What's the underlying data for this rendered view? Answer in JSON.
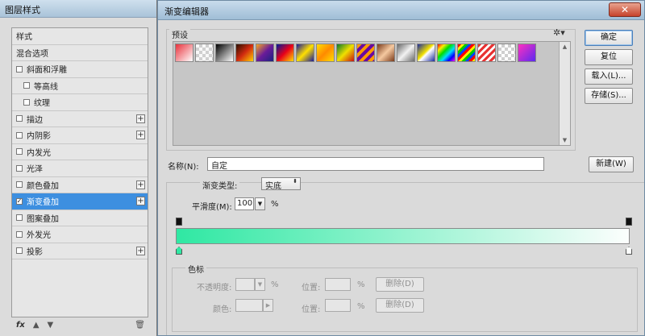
{
  "layer_style": {
    "title": "图层样式",
    "items": [
      {
        "label": "样式",
        "checkbox": false,
        "checked": false,
        "plus": false,
        "indent": false,
        "selected": false
      },
      {
        "label": "混合选项",
        "checkbox": false,
        "checked": false,
        "plus": false,
        "indent": false,
        "selected": false
      },
      {
        "label": "斜面和浮雕",
        "checkbox": true,
        "checked": false,
        "plus": false,
        "indent": false,
        "selected": false
      },
      {
        "label": "等高线",
        "checkbox": true,
        "checked": false,
        "plus": false,
        "indent": true,
        "selected": false
      },
      {
        "label": "纹理",
        "checkbox": true,
        "checked": false,
        "plus": false,
        "indent": true,
        "selected": false
      },
      {
        "label": "描边",
        "checkbox": true,
        "checked": false,
        "plus": true,
        "indent": false,
        "selected": false
      },
      {
        "label": "内阴影",
        "checkbox": true,
        "checked": false,
        "plus": true,
        "indent": false,
        "selected": false
      },
      {
        "label": "内发光",
        "checkbox": true,
        "checked": false,
        "plus": false,
        "indent": false,
        "selected": false
      },
      {
        "label": "光泽",
        "checkbox": true,
        "checked": false,
        "plus": false,
        "indent": false,
        "selected": false
      },
      {
        "label": "颜色叠加",
        "checkbox": true,
        "checked": false,
        "plus": true,
        "indent": false,
        "selected": false
      },
      {
        "label": "渐变叠加",
        "checkbox": true,
        "checked": true,
        "plus": true,
        "indent": false,
        "selected": true
      },
      {
        "label": "图案叠加",
        "checkbox": true,
        "checked": false,
        "plus": false,
        "indent": false,
        "selected": false
      },
      {
        "label": "外发光",
        "checkbox": true,
        "checked": false,
        "plus": false,
        "indent": false,
        "selected": false
      },
      {
        "label": "投影",
        "checkbox": true,
        "checked": false,
        "plus": true,
        "indent": false,
        "selected": false
      }
    ],
    "bottom": {
      "fx": "fx",
      "up": "▲",
      "down": "▼",
      "trash": "🗑"
    }
  },
  "gradient_editor": {
    "title": "渐变编辑器",
    "close_glyph": "✕",
    "presets_label": "预设",
    "gear_glyph": "✲▾",
    "scroll_up": "▲",
    "scroll_down": "▼",
    "buttons": {
      "ok": "确定",
      "reset": "复位",
      "load": "载入(L)...",
      "save": "存储(S)...",
      "new": "新建(W)"
    },
    "name_label": "名称(N):",
    "name_value": "自定",
    "type_label": "渐变类型:",
    "type_value": "实底",
    "type_arrow": "⬍",
    "smoothness_label": "平滑度(M):",
    "smoothness_value": "100",
    "smoothness_arrow": "▼",
    "percent": "%",
    "gradient_colors": {
      "start": "#2fe8a3",
      "end": "#fcfefd"
    },
    "stops_group_label": "色标",
    "opacity_label": "不透明度:",
    "position_label": "位置:",
    "delete_label": "删除(D)",
    "color_label": "颜色:",
    "color_arrow": "▶",
    "dropdown_arrow": "▼"
  },
  "swatches": [
    "linear-gradient(135deg,#e8323c,#ffffff)",
    "repeating-conic-gradient(#d0d0d0 0 25%,#f8f8f8 0 50%) 0 0/8px 8px, linear-gradient(135deg,#e83a3a,transparent)",
    "linear-gradient(135deg,#000000,#ffffff)",
    "linear-gradient(135deg,#2a1000,#d12a10 50%,#ffd000)",
    "linear-gradient(135deg,#f5a623,#6a1b9a,#1a237e)",
    "linear-gradient(135deg,#001a9a,#e8001a 50%,#ffdf00)",
    "linear-gradient(135deg,#1a1a9a,#ffe000 50%,#1a1a9a)",
    "linear-gradient(135deg,#ffdf00,#ff8a00 50%,#ffdf00)",
    "linear-gradient(135deg,#0a7a2a,#f0e000 50%,#c81010)",
    "repeating-linear-gradient(135deg,#ff9a00 0 4px,#6a0aa0 4px 8px)",
    "linear-gradient(135deg,#7a3a1a,#f5c9a0 50%,#7a3a1a)",
    "linear-gradient(135deg,#6a6a6a,#f2f2f2 50%,#6a6a6a)",
    "linear-gradient(135deg,#1a2aa0,#f0e000 45%,#ffffff 55%,#1a2aa0)",
    "linear-gradient(135deg,#ff0000,#ffee00,#00dd00,#00ddff,#0000ff,#ff00ff)",
    "repeating-linear-gradient(135deg,#ff0000 0 3px,#ffee00 3px 6px,#00cc00 6px 9px,#0044ff 9px 12px)",
    "repeating-linear-gradient(135deg,#e83232 0 3px,#ffffff 3px 6px)",
    "repeating-conic-gradient(#cfcfcf 0 25%,#ffffff 0 50%) 0 0/8px 8px",
    "linear-gradient(135deg,#ff30c0,#5a2af0)"
  ]
}
